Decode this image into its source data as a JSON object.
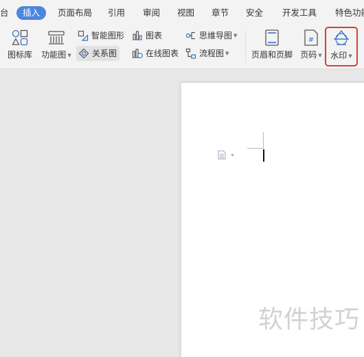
{
  "tabs": [
    "台",
    "插入",
    "页面布局",
    "引用",
    "审阅",
    "视图",
    "章节",
    "安全",
    "开发工具",
    "特色功能"
  ],
  "active_tab": "插入",
  "ribbon": {
    "icon_library": "图标库",
    "function_chart": "功能图",
    "smart_shape": "智能图形",
    "relation_chart": "关系图",
    "chart": "图表",
    "online_chart": "在线图表",
    "mind_map": "思维导图",
    "flowchart": "流程图",
    "header_footer": "页眉和页脚",
    "page_number": "页码",
    "watermark": "水印"
  },
  "document": {
    "watermark_text": "软件技巧"
  },
  "colors": {
    "accent": "#4b86df",
    "highlight_border": "#d73c3c",
    "watermark_text": "#d2d2d2"
  }
}
